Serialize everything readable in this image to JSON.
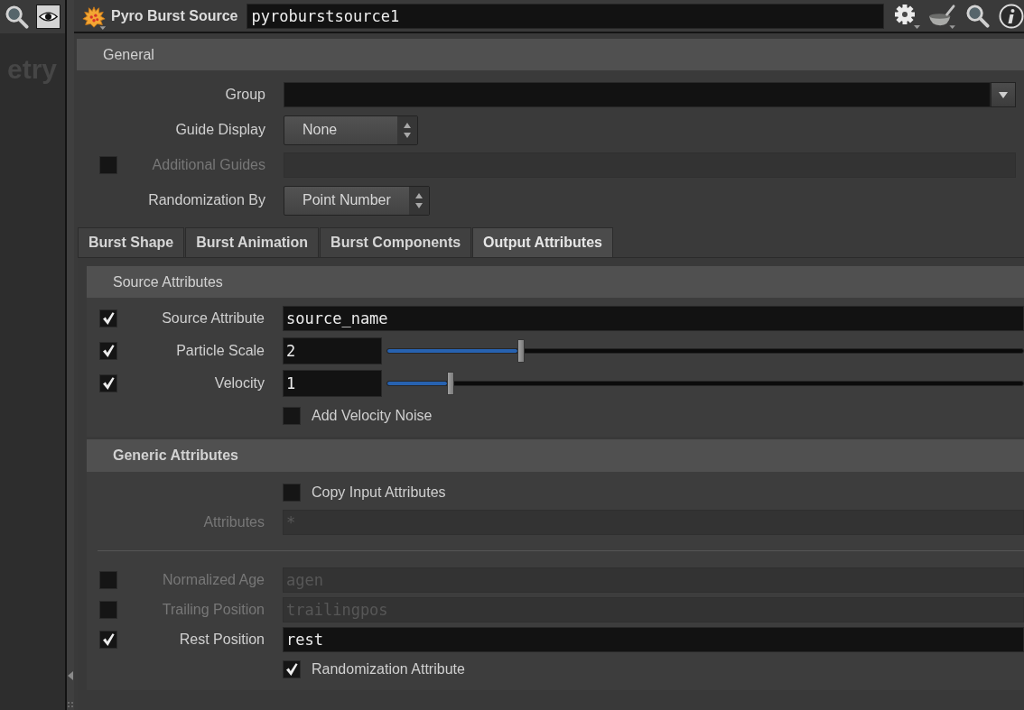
{
  "left_pane": {
    "network_label": "etry"
  },
  "header": {
    "node_type": "Pyro Burst Source",
    "node_name": "pyroburstsource1"
  },
  "general": {
    "title": "General",
    "parameters": [
      {
        "kind": "field_menu",
        "label": "Group",
        "disabled": false
      },
      {
        "kind": "menu",
        "label": "Guide Display",
        "value": "None",
        "disabled": false
      },
      {
        "kind": "field",
        "label": "Additional Guides",
        "checked": false,
        "disabled": true
      },
      {
        "kind": "menu",
        "label": "Randomization By",
        "value": "Point Number",
        "disabled": false
      }
    ]
  },
  "tabs": [
    {
      "label": "Burst Shape",
      "selected": false
    },
    {
      "label": "Burst Animation",
      "selected": false
    },
    {
      "label": "Burst Components",
      "selected": false
    },
    {
      "label": "Output Attributes",
      "selected": true
    }
  ],
  "sections": [
    {
      "title": "Source Attributes",
      "bold": false,
      "parameters": [
        {
          "kind": "field",
          "label": "Source Attribute",
          "checked": true,
          "disabled": false,
          "value": "source_name"
        },
        {
          "kind": "slider",
          "label": "Particle Scale",
          "checked": true,
          "disabled": false,
          "value": "2",
          "level": 0.21
        },
        {
          "kind": "slider",
          "label": "Velocity",
          "checked": true,
          "disabled": false,
          "value": "1",
          "level": 0.1
        },
        {
          "kind": "checkbox",
          "label": "Add Velocity Noise",
          "checked": false,
          "disabled": false
        }
      ]
    },
    {
      "title": "Generic Attributes",
      "bold": true,
      "parameters": [
        {
          "kind": "checkbox",
          "label": "Copy Input Attributes",
          "checked": false,
          "disabled": false
        },
        {
          "kind": "field",
          "label": "Attributes",
          "disabled": true,
          "value": "*"
        },
        {
          "kind": "separator"
        },
        {
          "kind": "field",
          "label": "Normalized Age",
          "checked": false,
          "disabled": true,
          "value": "agen"
        },
        {
          "kind": "field",
          "label": "Trailing Position",
          "checked": false,
          "disabled": true,
          "value": "trailingpos"
        },
        {
          "kind": "field",
          "label": "Rest Position",
          "checked": true,
          "disabled": false,
          "value": "rest"
        },
        {
          "kind": "checkbox",
          "label": "Randomization Attribute",
          "checked": true,
          "disabled": false
        }
      ]
    }
  ]
}
